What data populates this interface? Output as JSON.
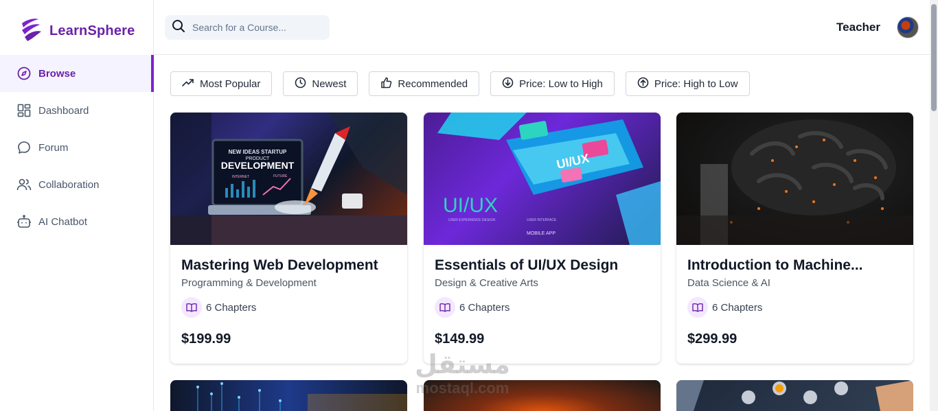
{
  "app": {
    "name": "LearnSphere",
    "brand_color": "#6b21a8"
  },
  "sidebar": {
    "items": [
      {
        "label": "Browse",
        "icon": "compass-icon",
        "active": true
      },
      {
        "label": "Dashboard",
        "icon": "grid-icon",
        "active": false
      },
      {
        "label": "Forum",
        "icon": "chat-bubble-icon",
        "active": false
      },
      {
        "label": "Collaboration",
        "icon": "users-icon",
        "active": false
      },
      {
        "label": "AI Chatbot",
        "icon": "bot-icon",
        "active": false
      }
    ]
  },
  "header": {
    "search_placeholder": "Search for a Course...",
    "user_role": "Teacher"
  },
  "filters": [
    {
      "label": "Most Popular",
      "icon": "trending-up-icon"
    },
    {
      "label": "Newest",
      "icon": "clock-icon"
    },
    {
      "label": "Recommended",
      "icon": "thumbs-up-icon"
    },
    {
      "label": "Price: Low to High",
      "icon": "arrow-down-circle-icon"
    },
    {
      "label": "Price: High to Low",
      "icon": "arrow-up-circle-icon"
    }
  ],
  "courses": [
    {
      "title": "Mastering Web Development",
      "category": "Programming & Development",
      "chapters": "6 Chapters",
      "price": "$199.99",
      "image_text": [
        "NEW IDEAS STARTUP",
        "PRODUCT",
        "DEVELOPMENT",
        "INTERNET",
        "FUTURE"
      ]
    },
    {
      "title": "Essentials of UI/UX Design",
      "category": "Design & Creative Arts",
      "chapters": "6 Chapters",
      "price": "$149.99",
      "image_text": [
        "UI/UX",
        "UI/UX",
        "USER EXPERIENCE DESIGN",
        "USER INTERFACE",
        "MOBILE APP"
      ]
    },
    {
      "title": "Introduction to Machine...",
      "category": "Data Science & AI",
      "chapters": "6 Chapters",
      "price": "$299.99"
    }
  ],
  "watermark": {
    "line1": "مستقل",
    "line2": "mostaql.com"
  }
}
